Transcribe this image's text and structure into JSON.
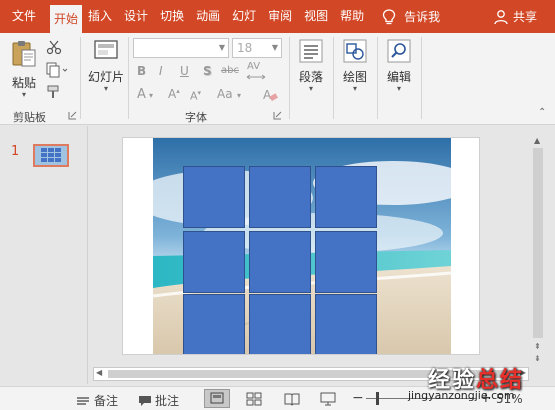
{
  "tabs": [
    {
      "label": "文件"
    },
    {
      "label": "开始"
    },
    {
      "label": "插入"
    },
    {
      "label": "设计"
    },
    {
      "label": "切换"
    },
    {
      "label": "动画"
    },
    {
      "label": "幻灯"
    },
    {
      "label": "审阅"
    },
    {
      "label": "视图"
    },
    {
      "label": "帮助"
    }
  ],
  "tell_me": "告诉我",
  "share": "共享",
  "ribbon": {
    "paste": "粘贴",
    "clipboard_group": "剪贴板",
    "slides": "幻灯片",
    "font_group": "字体",
    "font_size": "18",
    "paragraph": "段落",
    "drawing": "绘图",
    "editing": "编辑"
  },
  "thumbnail": {
    "number": "1"
  },
  "status": {
    "notes": "备注",
    "comments": "批注",
    "zoom": "51%"
  },
  "watermark": {
    "part1": "经验",
    "part2": "总结",
    "url": "jingyanzongjie.com"
  },
  "colors": {
    "accent": "#d24726",
    "tile": "#4472c4"
  }
}
